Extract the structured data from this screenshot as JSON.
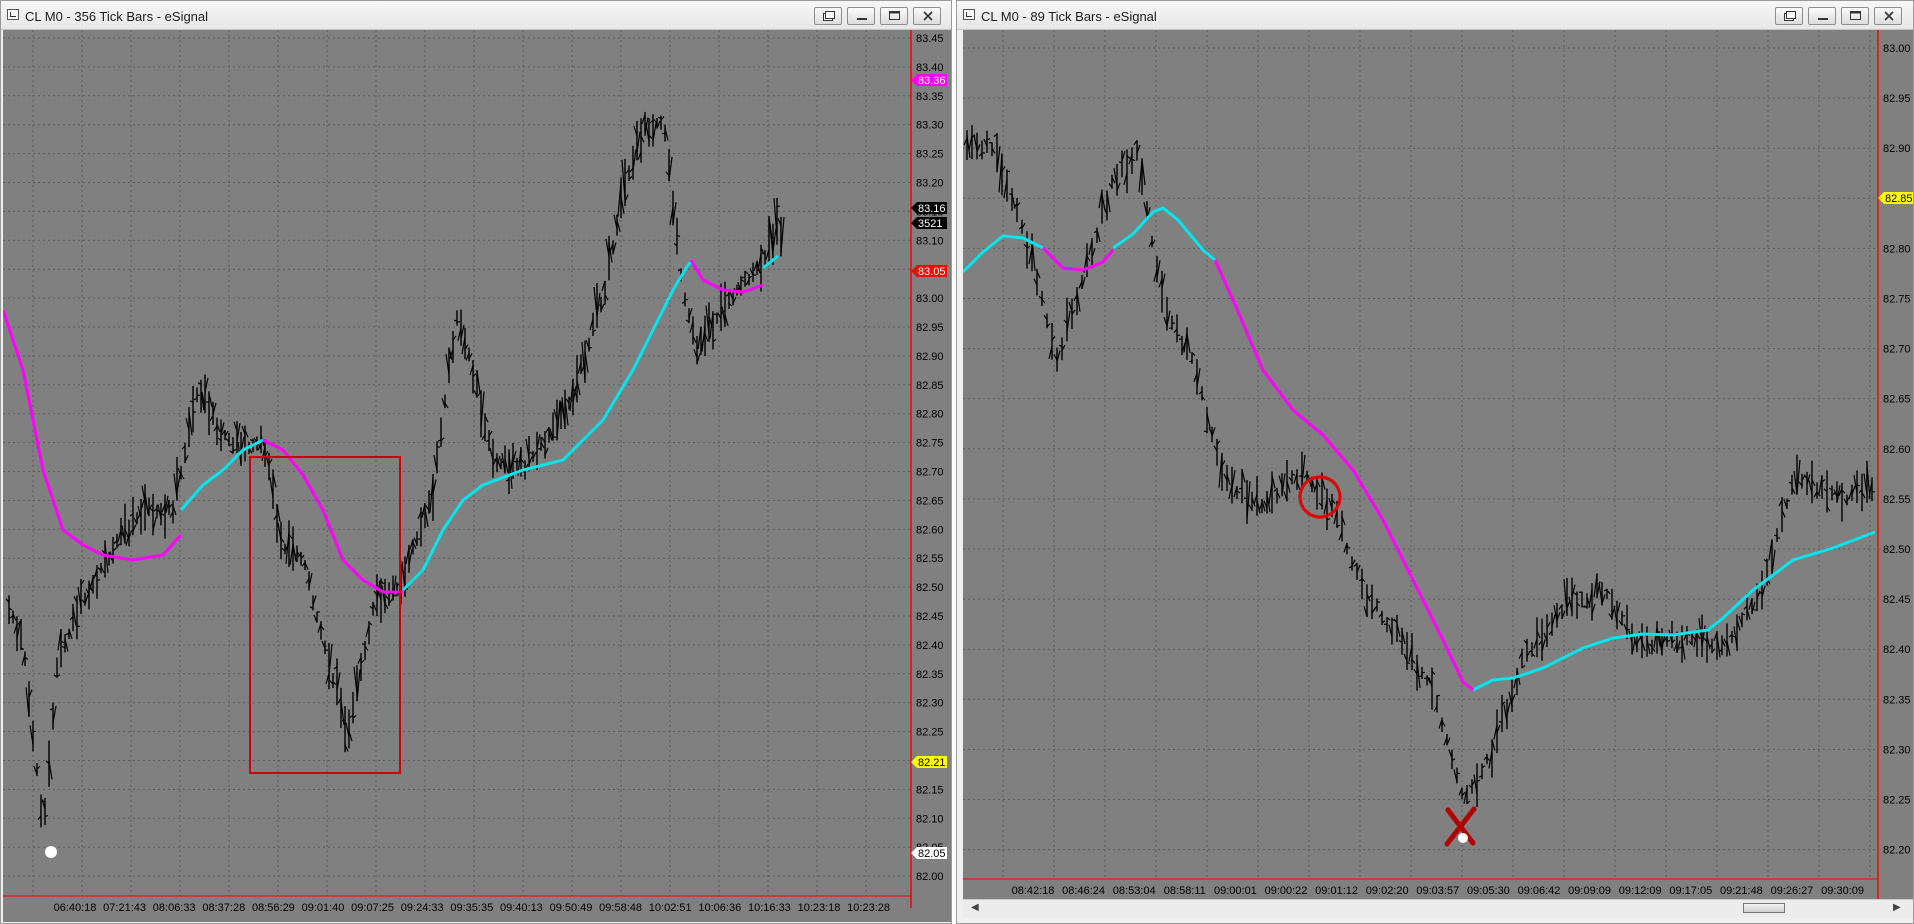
{
  "window_left": {
    "title": "CL M0 - 356 Tick Bars - eSignal",
    "price_ticks": [
      "83.45",
      "83.40",
      "83.35",
      "83.30",
      "83.25",
      "83.20",
      "83.15",
      "83.10",
      "83.05",
      "83.00",
      "82.95",
      "82.90",
      "82.85",
      "82.80",
      "82.75",
      "82.70",
      "82.65",
      "82.60",
      "82.55",
      "82.50",
      "82.45",
      "82.40",
      "82.35",
      "82.30",
      "82.25",
      "82.20",
      "82.15",
      "82.10",
      "82.05",
      "82.00"
    ],
    "time_ticks": [
      "06:40:18",
      "07:21:43",
      "08:06:33",
      "08:37:28",
      "08:56:29",
      "09:01:40",
      "09:07:25",
      "09:24:33",
      "09:35:35",
      "09:40:13",
      "09:50:49",
      "09:58:48",
      "10:02:51",
      "10:06:36",
      "10:16:33",
      "10:23:18",
      "10:23:28"
    ],
    "price_flags": [
      {
        "value": "83.36",
        "bg": "#ff00ff",
        "fg": "#ffffff"
      },
      {
        "value": "83.16",
        "bg": "#000000",
        "fg": "#ffffff"
      },
      {
        "value": "3521",
        "bg": "#000000",
        "fg": "#ffffff"
      },
      {
        "value": "83.05",
        "bg": "#ff0000",
        "fg": "#ffffff"
      },
      {
        "value": "82.21",
        "bg": "#ffff00",
        "fg": "#000000"
      },
      {
        "value": "82.05",
        "bg": "#ffffff",
        "fg": "#000000"
      }
    ]
  },
  "window_right": {
    "title": "CL M0 - 89 Tick Bars - eSignal",
    "price_ticks": [
      "83.00",
      "82.95",
      "82.90",
      "82.85",
      "82.80",
      "82.75",
      "82.70",
      "82.65",
      "82.60",
      "82.55",
      "82.50",
      "82.45",
      "82.40",
      "82.35",
      "82.30",
      "82.25",
      "82.20"
    ],
    "time_ticks": [
      "08:42:18",
      "08:46:24",
      "08:53:04",
      "08:58:11",
      "09:00:01",
      "09:00:22",
      "09:01:12",
      "09:02:20",
      "09:03:57",
      "09:05:30",
      "09:06:42",
      "09:09:09",
      "09:12:09",
      "09:17:05",
      "09:21:48",
      "09:26:27",
      "09:30:09"
    ],
    "price_flags": [
      {
        "value": "82.85",
        "bg": "#ffff00",
        "fg": "#000000"
      }
    ]
  },
  "colors": {
    "chart_bg": "#808080",
    "bars": "#000000",
    "ma_up": "#00e5ee",
    "ma_down": "#ff00ff",
    "annotation": "#e00000",
    "grid": "#5a5a5a"
  },
  "icons": [
    "restore-icon",
    "minimize-icon",
    "maximize-icon",
    "close-icon"
  ]
}
